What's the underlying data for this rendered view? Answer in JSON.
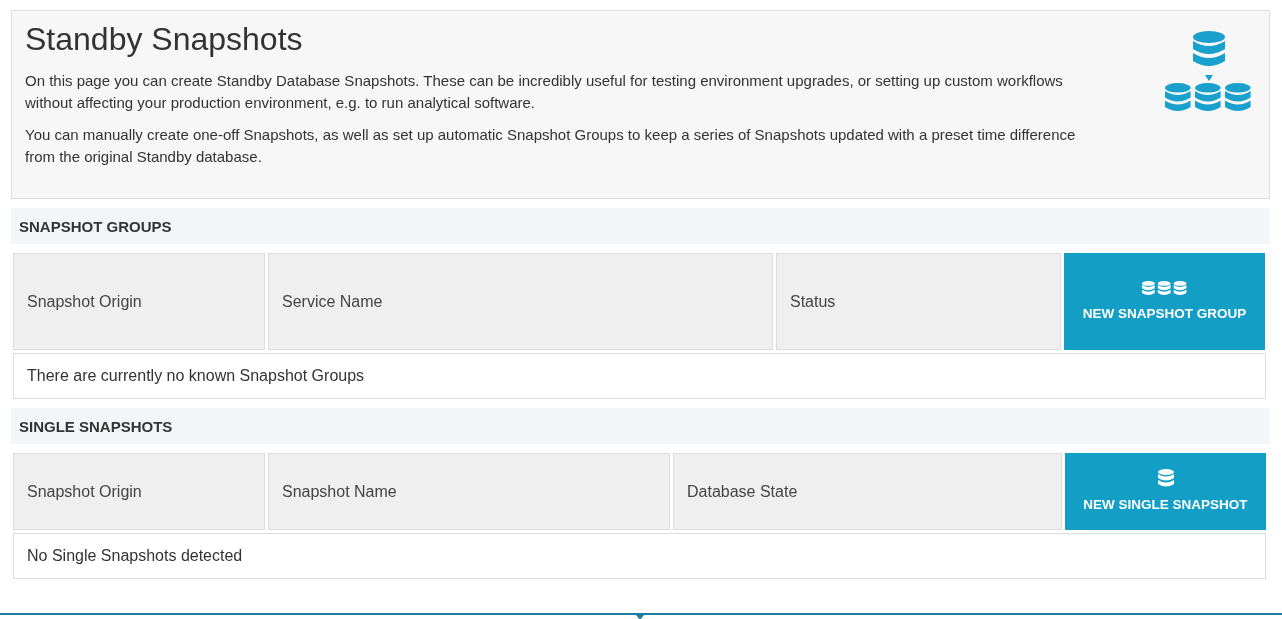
{
  "header": {
    "title": "Standby Snapshots",
    "paragraphs": [
      "On this page you can create Standby Database Snapshots. These can be incredibly useful for testing environment upgrades, or setting up custom workflows without affecting your production environment, e.g. to run analytical software.",
      "You can manually create one-off Snapshots, as well as set up automatic Snapshot Groups to keep a series of Snapshots updated with a preset time difference from the original Standby database."
    ]
  },
  "sections": [
    {
      "kind": "group",
      "title": "SNAPSHOT GROUPS",
      "columns": [
        "Snapshot Origin",
        "Service Name",
        "Status"
      ],
      "button": "NEW SNAPSHOT GROUP",
      "empty_message": "There are currently no known Snapshot Groups"
    },
    {
      "kind": "single",
      "title": "SINGLE SNAPSHOTS",
      "columns": [
        "Snapshot Origin",
        "Snapshot Name",
        "Database State"
      ],
      "button": "NEW SINGLE SNAPSHOT",
      "empty_message": "No Single Snapshots detected"
    }
  ]
}
